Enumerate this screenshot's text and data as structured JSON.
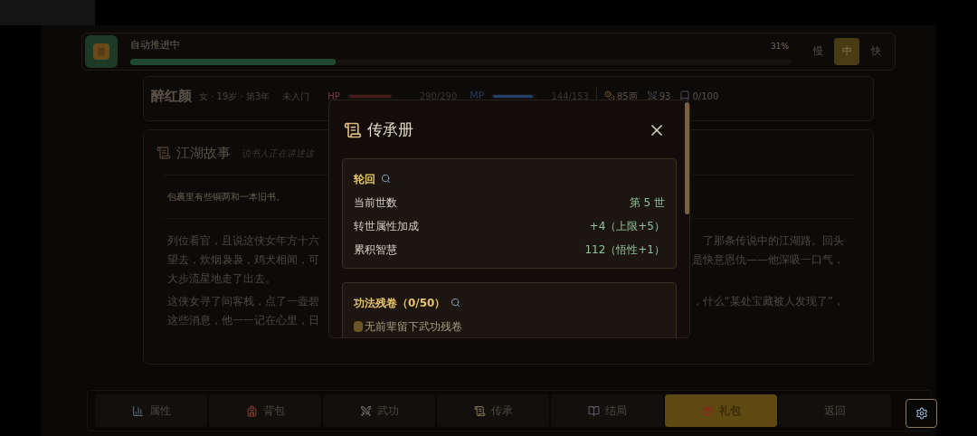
{
  "auto_bar": {
    "label": "自动推进中",
    "level": 0.31,
    "percent": "31%",
    "speeds": [
      {
        "label": "慢",
        "selected": false
      },
      {
        "label": "中",
        "selected": true
      },
      {
        "label": "快",
        "selected": false
      }
    ]
  },
  "character": {
    "name": "醉红颜",
    "info": "女 · 19岁 · 第3年",
    "rank": "未入门",
    "hp": {
      "label": "HP",
      "level": 1,
      "reading": "290/290"
    },
    "mp": {
      "label": "MP",
      "level": 0.94,
      "reading": "144/153"
    },
    "money": "85两",
    "attack": "93",
    "books": "0/100"
  },
  "story": {
    "title": "江湖故事",
    "subtitle": "说书人正在讲述这",
    "note": "包裹里有些铜两和一本旧书。",
    "lines": [
      {
        "left": "列位看官，且说这侠女年方十六",
        "right": "了那条传说中的江湖路。回头"
      },
      {
        "left": "望去，炊烟袅袅，鸡犬相闻，可",
        "right": "是快意恩仇——他深吸一口气，"
      },
      {
        "left": "大步流星地走了出去。"
      },
      {
        "left": "这侠女寻了间客栈，点了一壶碧",
        "right": "，什么“某处宝藏被人发现了”，"
      },
      {
        "left": "这些消息，他一一记在心里，日"
      }
    ]
  },
  "modal": {
    "title": "传承册",
    "sections": [
      {
        "title": "轮回",
        "rows": [
          {
            "label": "当前世数",
            "value": "第 5 世"
          },
          {
            "label": "转世属性加成",
            "value": "+4（上限+5）"
          },
          {
            "label": "累积智慧",
            "value": "112（悟性+1）"
          }
        ]
      },
      {
        "title": "功法残卷（0/50）",
        "empty_text": "无前辈留下武功残卷"
      }
    ]
  },
  "nav": [
    {
      "label": "属性",
      "selected": false
    },
    {
      "label": "背包",
      "selected": false
    },
    {
      "label": "武功",
      "selected": false
    },
    {
      "label": "传承",
      "selected": false
    },
    {
      "label": "结局",
      "selected": false
    },
    {
      "label": "礼包",
      "selected": true
    },
    {
      "label": "返回",
      "selected": false
    }
  ]
}
